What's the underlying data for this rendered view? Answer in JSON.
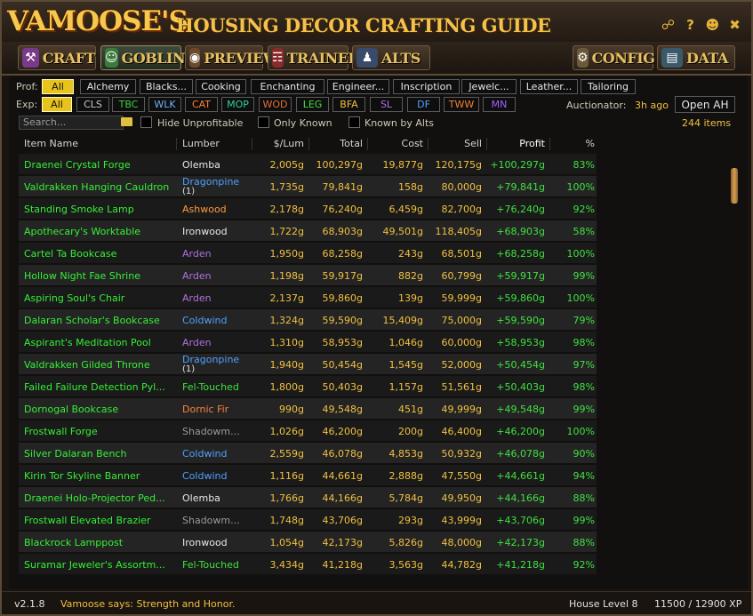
{
  "app": {
    "logo": "VAMOOSE'S",
    "title": "HOUSING DECOR CRAFTING GUIDE"
  },
  "tabs": [
    {
      "label": "CRAFT"
    },
    {
      "label": "GOBLIN"
    },
    {
      "label": "PREVIEW"
    },
    {
      "label": "TRAINERS"
    },
    {
      "label": "ALTS"
    },
    {
      "label": "CONFIG"
    },
    {
      "label": "DATA"
    }
  ],
  "filters": {
    "prof_label": "Prof:",
    "profs": [
      "All",
      "Alchemy",
      "Blacks...",
      "Cooking",
      "Enchanting",
      "Engineer...",
      "Inscription",
      "Jewelc...",
      "Leather...",
      "Tailoring"
    ],
    "exp_label": "Exp:",
    "exps": [
      "All",
      "CLS",
      "TBC",
      "WLK",
      "CAT",
      "MOP",
      "WOD",
      "LEG",
      "BFA",
      "SL",
      "DF",
      "TWW",
      "MN"
    ],
    "search_placeholder": "Search...",
    "hide_unprofitable": "Hide Unprofitable",
    "only_known": "Only Known",
    "known_by_alts": "Known by Alts",
    "auctionator_label": "Auctionator:",
    "auctionator_age": "3h ago",
    "open_ah": "Open AH",
    "items_count": "244 items"
  },
  "table": {
    "headers": [
      "Item Name",
      "Lumber",
      "$/Lum",
      "Total",
      "Cost",
      "Sell",
      "Profit",
      "%"
    ],
    "rows": [
      {
        "name": "Draenei Crystal Forge",
        "lumber": "Olemba",
        "lumsub": "",
        "per_lum": "2,005g",
        "total": "100,297g",
        "cost": "19,877g",
        "sell": "120,175g",
        "profit": "+100,297g",
        "pct": "83%"
      },
      {
        "name": "Valdrakken Hanging Cauldron",
        "lumber": "Dragonpine",
        "lumsub": "(1)",
        "per_lum": "1,735g",
        "total": "79,841g",
        "cost": "158g",
        "sell": "80,000g",
        "profit": "+79,841g",
        "pct": "100%"
      },
      {
        "name": "Standing Smoke Lamp",
        "lumber": "Ashwood",
        "lumsub": "",
        "per_lum": "2,178g",
        "total": "76,240g",
        "cost": "6,459g",
        "sell": "82,700g",
        "profit": "+76,240g",
        "pct": "92%"
      },
      {
        "name": "Apothecary's Worktable",
        "lumber": "Ironwood",
        "lumsub": "",
        "per_lum": "1,722g",
        "total": "68,903g",
        "cost": "49,501g",
        "sell": "118,405g",
        "profit": "+68,903g",
        "pct": "58%"
      },
      {
        "name": "Cartel Ta Bookcase",
        "lumber": "Arden",
        "lumsub": "",
        "per_lum": "1,950g",
        "total": "68,258g",
        "cost": "243g",
        "sell": "68,501g",
        "profit": "+68,258g",
        "pct": "100%"
      },
      {
        "name": "Hollow Night Fae Shrine",
        "lumber": "Arden",
        "lumsub": "",
        "per_lum": "1,198g",
        "total": "59,917g",
        "cost": "882g",
        "sell": "60,799g",
        "profit": "+59,917g",
        "pct": "99%"
      },
      {
        "name": "Aspiring Soul's Chair",
        "lumber": "Arden",
        "lumsub": "",
        "per_lum": "2,137g",
        "total": "59,860g",
        "cost": "139g",
        "sell": "59,999g",
        "profit": "+59,860g",
        "pct": "100%"
      },
      {
        "name": "Dalaran Scholar's Bookcase",
        "lumber": "Coldwind",
        "lumsub": "",
        "per_lum": "1,324g",
        "total": "59,590g",
        "cost": "15,409g",
        "sell": "75,000g",
        "profit": "+59,590g",
        "pct": "79%"
      },
      {
        "name": "Aspirant's Meditation Pool",
        "lumber": "Arden",
        "lumsub": "",
        "per_lum": "1,310g",
        "total": "58,953g",
        "cost": "1,046g",
        "sell": "60,000g",
        "profit": "+58,953g",
        "pct": "98%"
      },
      {
        "name": "Valdrakken Gilded Throne",
        "lumber": "Dragonpine",
        "lumsub": "(1)",
        "per_lum": "1,940g",
        "total": "50,454g",
        "cost": "1,545g",
        "sell": "52,000g",
        "profit": "+50,454g",
        "pct": "97%"
      },
      {
        "name": "Failed Failure Detection Pyl...",
        "lumber": "Fel-Touched",
        "lumsub": "",
        "per_lum": "1,800g",
        "total": "50,403g",
        "cost": "1,157g",
        "sell": "51,561g",
        "profit": "+50,403g",
        "pct": "98%"
      },
      {
        "name": "Dornogal Bookcase",
        "lumber": "Dornic Fir",
        "lumsub": "",
        "per_lum": "990g",
        "total": "49,548g",
        "cost": "451g",
        "sell": "49,999g",
        "profit": "+49,548g",
        "pct": "99%"
      },
      {
        "name": "Frostwall Forge",
        "lumber": "Shadowm...",
        "lumsub": "",
        "per_lum": "1,026g",
        "total": "46,200g",
        "cost": "200g",
        "sell": "46,400g",
        "profit": "+46,200g",
        "pct": "100%"
      },
      {
        "name": "Silver Dalaran Bench",
        "lumber": "Coldwind",
        "lumsub": "",
        "per_lum": "2,559g",
        "total": "46,078g",
        "cost": "4,853g",
        "sell": "50,932g",
        "profit": "+46,078g",
        "pct": "90%"
      },
      {
        "name": "Kirin Tor Skyline Banner",
        "lumber": "Coldwind",
        "lumsub": "",
        "per_lum": "1,116g",
        "total": "44,661g",
        "cost": "2,888g",
        "sell": "47,550g",
        "profit": "+44,661g",
        "pct": "94%"
      },
      {
        "name": "Draenei Holo-Projector Ped...",
        "lumber": "Olemba",
        "lumsub": "",
        "per_lum": "1,766g",
        "total": "44,166g",
        "cost": "5,784g",
        "sell": "49,950g",
        "profit": "+44,166g",
        "pct": "88%"
      },
      {
        "name": "Frostwall Elevated Brazier",
        "lumber": "Shadowm...",
        "lumsub": "",
        "per_lum": "1,748g",
        "total": "43,706g",
        "cost": "293g",
        "sell": "43,999g",
        "profit": "+43,706g",
        "pct": "99%"
      },
      {
        "name": "Blackrock Lamppost",
        "lumber": "Ironwood",
        "lumsub": "",
        "per_lum": "1,054g",
        "total": "42,173g",
        "cost": "5,826g",
        "sell": "48,000g",
        "profit": "+42,173g",
        "pct": "88%"
      },
      {
        "name": "Suramar Jeweler's Assortm...",
        "lumber": "Fel-Touched",
        "lumsub": "",
        "per_lum": "3,434g",
        "total": "41,218g",
        "cost": "3,563g",
        "sell": "44,782g",
        "profit": "+41,218g",
        "pct": "92%"
      }
    ]
  },
  "footer": {
    "version": "v2.1.8",
    "says": "Vamoose says: Strength and Honor.",
    "house_level": "House Level 8",
    "xp": "11500 / 12900 XP"
  },
  "colors": {
    "accent_yellow": "#e7c31c",
    "name_green": "#35f035",
    "gold_text": "#f0c040",
    "profit_green": "#40e040",
    "title_gold": "#f2c24a"
  },
  "icons": {
    "title": [
      "link-icon",
      "help-icon",
      "characters-icon",
      "close-icon"
    ],
    "tabs": [
      "anvil-icon",
      "goblin-icon",
      "eye-icon",
      "book-icon",
      "people-icon",
      "gear-icon",
      "data-icon"
    ]
  }
}
